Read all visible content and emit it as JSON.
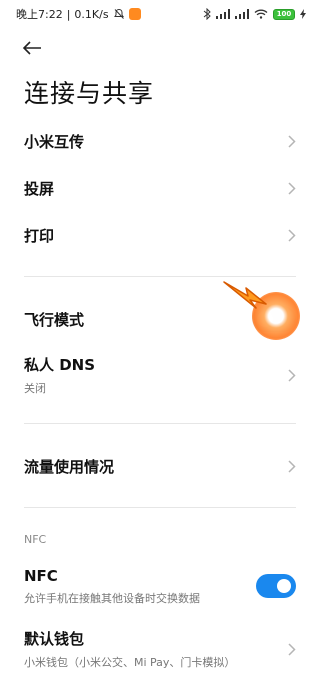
{
  "status_bar": {
    "time": "晚上7:22",
    "speed": "0.1K/s",
    "battery": "100"
  },
  "header": {
    "title": "连接与共享"
  },
  "settings": {
    "mi_share": {
      "label": "小米互传"
    },
    "cast": {
      "label": "投屏"
    },
    "print": {
      "label": "打印"
    },
    "airplane_mode": {
      "label": "飞行模式",
      "enabled": false
    },
    "private_dns": {
      "label": "私人 DNS",
      "value": "关闭"
    },
    "data_usage": {
      "label": "流量使用情况"
    }
  },
  "nfc_section": {
    "header": "NFC",
    "nfc": {
      "label": "NFC",
      "description": "允许手机在接触其他设备时交换数据",
      "enabled": true
    },
    "default_wallet": {
      "label": "默认钱包",
      "value": "小米钱包（小米公交、Mi Pay、门卡模拟）"
    }
  },
  "colors": {
    "accent": "#1a88ee",
    "highlight": "#ff7a1e"
  }
}
